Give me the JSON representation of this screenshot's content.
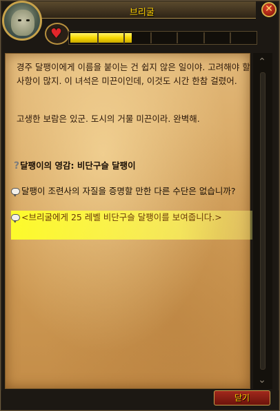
{
  "window": {
    "title": "브리굴",
    "close_glyph": "✕",
    "heart_glyph": "♥",
    "progress_fraction": 0.33,
    "progress_segments": 7
  },
  "quest": {
    "paragraph1": "경주 달팽이에게 이름을 붙이는 건 쉽지 않은 일이야. 고려해야 할 사항이 많지. 이 녀석은 미끈이인데, 이것도 시간 한참 걸렸어.",
    "paragraph2": "고생한 보람은 있군. 도시의 거물 미끈이라. 완벽해.",
    "objective_icon": "?",
    "objective": "달팽이의 영감: 비단구슬 달팽이",
    "options": [
      {
        "text": "달팽이 조련사의 자질을 증명할 만한 다른 수단은 없습니까?"
      },
      {
        "text": "<브리굴에게 25 레벨 비단구슬 달팽이를 보여줍니다.>"
      }
    ]
  },
  "scrollbar": {
    "up_glyph": "⌃",
    "down_glyph": "⌄"
  },
  "footer": {
    "close_label": "닫기"
  },
  "colors": {
    "title": "#ffd100",
    "parchment": "#d9a866",
    "highlight": "#ffff33",
    "progress": "#f7d800"
  }
}
